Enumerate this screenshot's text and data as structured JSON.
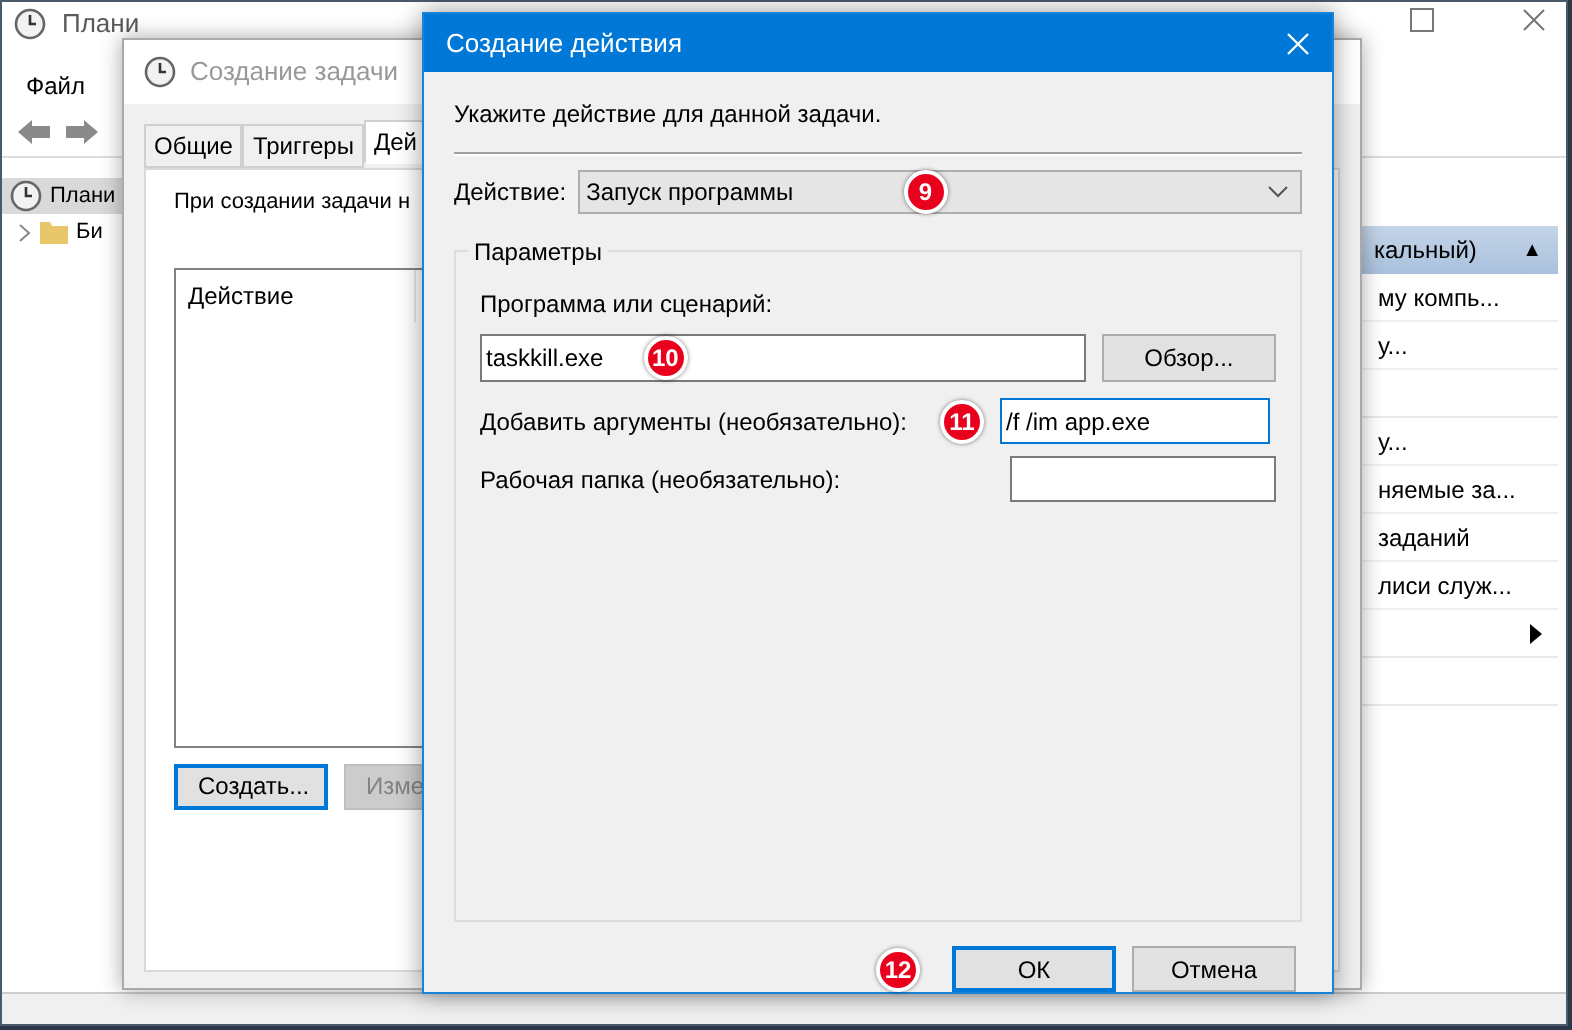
{
  "main_window": {
    "title": "Плани",
    "menu": [
      "Файл"
    ],
    "tree": [
      {
        "label": "Плани",
        "selected": true,
        "children": [
          {
            "label": "Би",
            "selected": false,
            "expanded": false
          }
        ]
      }
    ],
    "actions_pane": {
      "header": "кальный)",
      "collapse_glyph": "▲",
      "items": [
        {
          "kind": "text",
          "label": "му компь..."
        },
        {
          "kind": "text",
          "label": "у..."
        },
        {
          "kind": "blank"
        },
        {
          "kind": "text",
          "label": "у..."
        },
        {
          "kind": "text",
          "label": "няемые за..."
        },
        {
          "kind": "text",
          "label": "заданий"
        },
        {
          "kind": "text",
          "label": "лиси служ..."
        },
        {
          "kind": "submenu"
        },
        {
          "kind": "blank"
        }
      ]
    }
  },
  "task_window": {
    "title": "Создание задачи",
    "tabs": [
      {
        "label": "Общие",
        "selected": false
      },
      {
        "label": "Триггеры",
        "selected": false
      },
      {
        "label": "Дей",
        "selected": true
      }
    ],
    "description": "При создании задачи н",
    "table": {
      "columns": [
        "Действие"
      ]
    },
    "buttons": [
      {
        "label": "Создать...",
        "focused": true,
        "disabled": false
      },
      {
        "label": "Изме",
        "focused": false,
        "disabled": true
      }
    ]
  },
  "action_dialog": {
    "title": "Создание действия",
    "prompt": "Укажите действие для данной задачи.",
    "action": {
      "label": "Действие:",
      "value": "Запуск программы",
      "badge": "9"
    },
    "group": "Параметры",
    "program": {
      "label": "Программа или сценарий:",
      "value": "taskkill.exe",
      "badge": "10",
      "browse": "Обзор..."
    },
    "arguments": {
      "label": "Добавить аргументы (необязательно):",
      "value": "/f /im app.exe",
      "badge": "11",
      "focused": true
    },
    "folder": {
      "label": "Рабочая папка (необязательно):",
      "focused": false
    },
    "ok": {
      "label": "ОК",
      "badge": "12",
      "focused": true
    },
    "cancel": {
      "label": "Отмена",
      "focused": false
    }
  }
}
